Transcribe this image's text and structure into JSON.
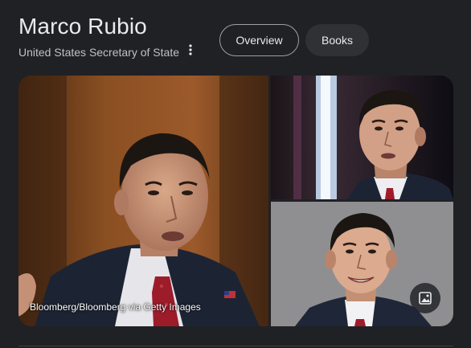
{
  "entity": {
    "name": "Marco Rubio",
    "description": "United States Secretary of State",
    "more_icon": "more-vert-icon"
  },
  "tabs": [
    {
      "label": "Overview",
      "selected": true
    },
    {
      "label": "Books",
      "selected": false
    }
  ],
  "images": {
    "main_caption": "Bloomberg/Bloomberg via Getty Images",
    "search_icon": "image-search-icon"
  },
  "colors": {
    "background": "#202124",
    "text": "#e8eaed",
    "subtext": "#bdc1c6",
    "chip_border": "#9aa0a6",
    "chip_fill": "#303134"
  }
}
